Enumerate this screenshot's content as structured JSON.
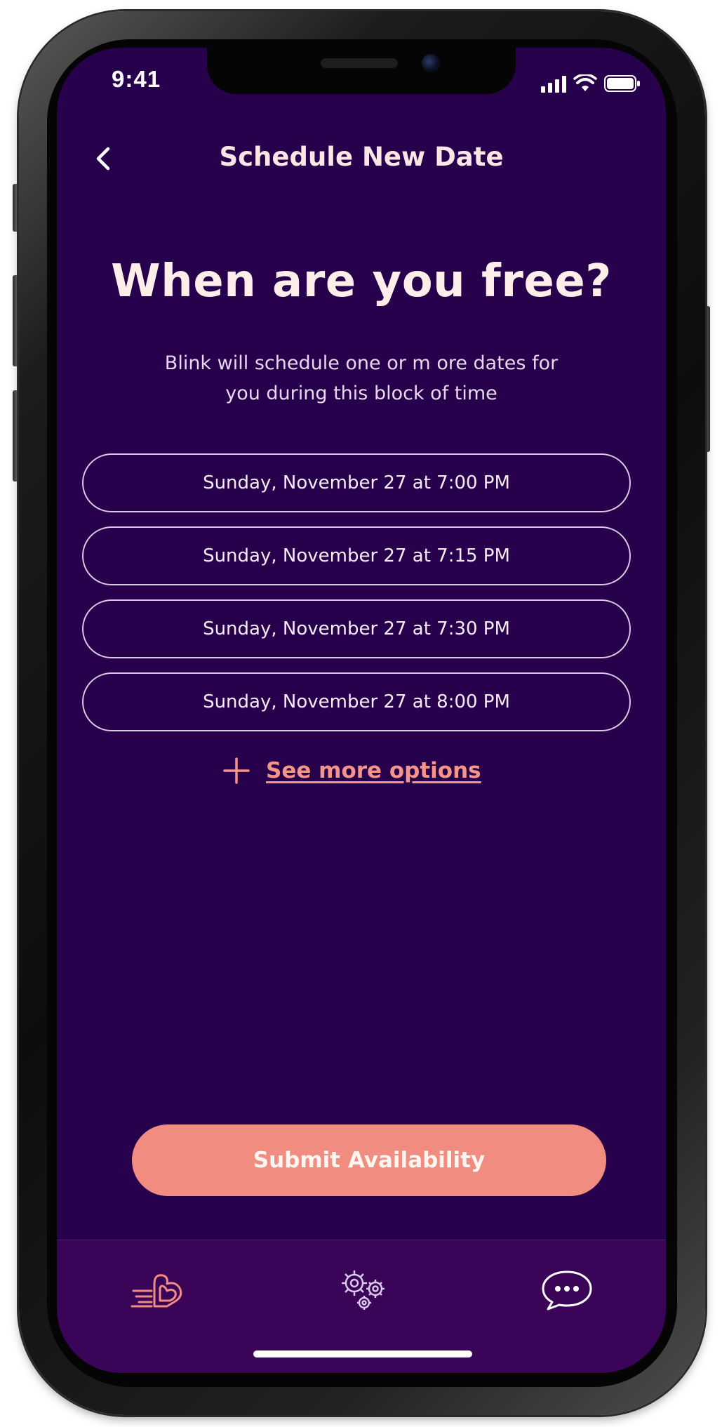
{
  "status_bar": {
    "time": "9:41"
  },
  "header": {
    "title": "Schedule New Date"
  },
  "main": {
    "headline": "When are you free?",
    "subtitle_line1": "Blink will schedule one or m ore dates for",
    "subtitle_line2": "you during this block of time",
    "options": [
      {
        "label": "Sunday, November 27 at 7:00 PM"
      },
      {
        "label": "Sunday, November 27 at 7:15 PM"
      },
      {
        "label": "Sunday, November 27 at 7:30 PM"
      },
      {
        "label": "Sunday, November 27 at 8:00 PM"
      }
    ],
    "see_more_label": "See more options",
    "submit_label": "Submit Availability"
  },
  "tab_bar": {
    "items": [
      {
        "icon": "heart-logo-icon"
      },
      {
        "icon": "gears-icon"
      },
      {
        "icon": "chat-bubble-icon"
      }
    ]
  },
  "colors": {
    "background": "#27014b",
    "tab_bar": "#3a0459",
    "accent": "#f18d80",
    "link": "#f5958a",
    "text_light": "#fdeeea"
  }
}
